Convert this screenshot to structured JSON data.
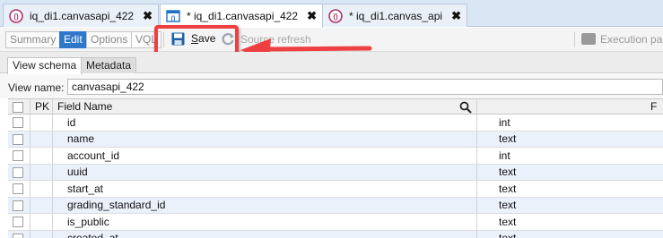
{
  "doc_tabs": [
    {
      "label": "iq_di1.canvasapi_422",
      "close": "✖"
    },
    {
      "label": "* iq_di1.canvasapi_422",
      "close": "✖"
    },
    {
      "label": "* iq_di1.canvas_api",
      "close": "✖"
    }
  ],
  "toolbar": {
    "mode_tabs": [
      "Summary",
      "Edit",
      "Options",
      "VQL"
    ],
    "save_label": "Save",
    "source_refresh_label": "Source refresh",
    "execution_label": "Execution par"
  },
  "sub_tabs": [
    "View schema",
    "Metadata"
  ],
  "view_name": {
    "label": "View name:",
    "value": "canvasapi_422"
  },
  "grid": {
    "columns": {
      "pk": "PK",
      "field_name": "Field Name",
      "type": "F"
    },
    "rows": [
      {
        "name": "id",
        "type": "int"
      },
      {
        "name": "name",
        "type": "text"
      },
      {
        "name": "account_id",
        "type": "int"
      },
      {
        "name": "uuid",
        "type": "text"
      },
      {
        "name": "start_at",
        "type": "text"
      },
      {
        "name": "grading_standard_id",
        "type": "text"
      },
      {
        "name": "is_public",
        "type": "text"
      },
      {
        "name": "created_at",
        "type": "text"
      }
    ]
  },
  "colors": {
    "active_tab": "#2f77c9",
    "highlight": "#ee3f42",
    "tabbar": "#d9e6f4",
    "row_alt": "#eaf1fb"
  }
}
